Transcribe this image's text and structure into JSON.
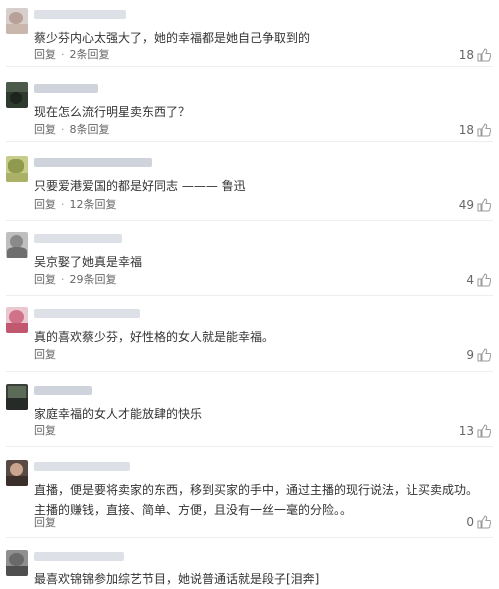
{
  "comments": [
    {
      "text": "蔡少芬内心太强大了，她的幸福都是她自己争取到的",
      "reply": "回复",
      "replies": "2条回复",
      "likes": "18"
    },
    {
      "text": "现在怎么流行明星卖东西了？",
      "reply": "回复",
      "replies": "8条回复",
      "likes": "18"
    },
    {
      "text": "只要爱港爱国的都是好同志 ——— 鲁迅",
      "reply": "回复",
      "replies": "12条回复",
      "likes": "49"
    },
    {
      "text": "吴京娶了她真是幸福",
      "reply": "回复",
      "replies": "29条回复",
      "likes": "4"
    },
    {
      "text": "真的喜欢蔡少芬，好性格的女人就是能幸福。",
      "reply": "回复",
      "likes": "9"
    },
    {
      "text": "家庭幸福的女人才能放肆的快乐",
      "reply": "回复",
      "likes": "13"
    },
    {
      "text": "直播，便是要将卖家的东西，移到买家的手中，通过主播的现行说法，让买卖成功。主播的赚钱，直接、简单、方便，且没有一丝一毫的分险。。",
      "reply": "回复",
      "likes": "0"
    },
    {
      "text": "最喜欢锦锦参加综艺节目，她说普通话就是段子[泪奔]"
    }
  ]
}
